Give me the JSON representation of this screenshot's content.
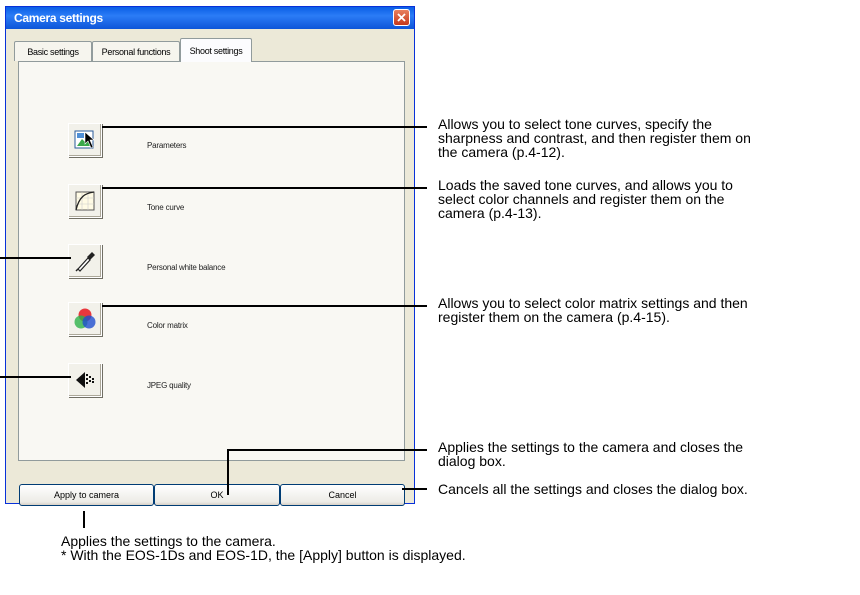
{
  "window": {
    "title": "Camera settings"
  },
  "tabs": [
    {
      "label": "Basic settings",
      "active": false
    },
    {
      "label": "Personal functions",
      "active": false
    },
    {
      "label": "Shoot settings",
      "active": true
    }
  ],
  "features": [
    {
      "label": "Parameters",
      "icon": "parameters-icon"
    },
    {
      "label": "Tone curve",
      "icon": "tone-curve-icon"
    },
    {
      "label": "Personal white balance",
      "icon": "eyedropper-icon"
    },
    {
      "label": "Color matrix",
      "icon": "color-matrix-icon"
    },
    {
      "label": "JPEG quality",
      "icon": "jpeg-quality-icon"
    }
  ],
  "buttons": {
    "apply": "Apply to camera",
    "ok": "OK",
    "cancel": "Cancel"
  },
  "annotations": {
    "parameters": [
      "Allows you to select tone curves, specify the",
      "sharpness and contrast, and then register them on",
      "the camera (p.4-12)."
    ],
    "tone_curve": [
      "Loads the saved tone curves, and allows you to",
      "select color channels and register them on the",
      "camera (p.4-13)."
    ],
    "color_matrix": [
      "Allows you to select color matrix settings and then",
      "register them on the camera (p.4-15)."
    ],
    "ok": [
      "Applies the settings to the camera and closes the",
      "dialog box."
    ],
    "cancel": [
      "Cancels all the settings and closes the dialog box."
    ],
    "apply": [
      "Applies the settings to the camera.",
      "*  With the EOS-1Ds and EOS-1D, the [Apply] button is displayed."
    ]
  }
}
